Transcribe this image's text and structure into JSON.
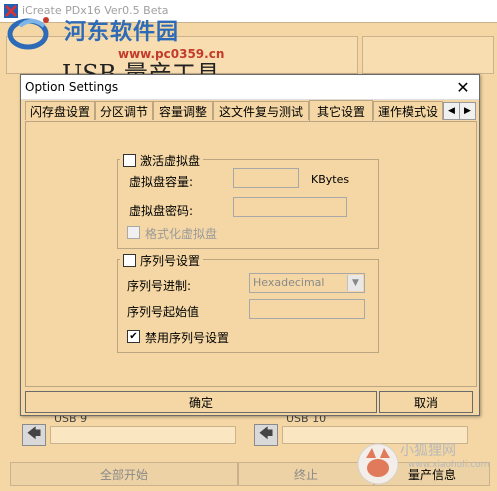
{
  "app": {
    "title": "iCreate PDx16 Ver0.5 Beta",
    "header_text": "USB 量产工具",
    "watermark_site": "河东软件园",
    "watermark_url": "www.pc0359.cn"
  },
  "ports": {
    "left_label": "USB 9",
    "right_label": "USB 10"
  },
  "bottom_bar": {
    "start_all": "全部开始",
    "stop": "终止",
    "mass_info": "量产信息"
  },
  "dialog": {
    "title": "Option Settings",
    "tabs": [
      {
        "label": "闪存盘设置"
      },
      {
        "label": "分区调节"
      },
      {
        "label": "容量调整"
      },
      {
        "label": "这文件复与测试"
      },
      {
        "label": "其它设置",
        "active": true
      },
      {
        "label": "運作模式设"
      }
    ],
    "virtual_disk": {
      "legend": "激活虚拟盘",
      "checked": false,
      "capacity_label": "虚拟盘容量:",
      "capacity_unit": "KBytes",
      "capacity_value": "",
      "password_label": "虚拟盘密码:",
      "password_value": "",
      "format_label": "格式化虚拟盘",
      "format_checked": false
    },
    "serial": {
      "legend": "序列号设置",
      "checked": false,
      "base_label": "序列号进制:",
      "base_value": "Hexadecimal",
      "start_label": "序列号起始值",
      "start_value": "",
      "disable_label": "禁用序列号设置",
      "disable_checked": true
    },
    "ok": "确定",
    "cancel": "取消"
  },
  "corner_watermark": {
    "text": "小狐狸网",
    "url": "www.xiaohuli.com"
  },
  "colors": {
    "background": "#f4d7a4",
    "watermark_blue": "#2d6bb8"
  }
}
